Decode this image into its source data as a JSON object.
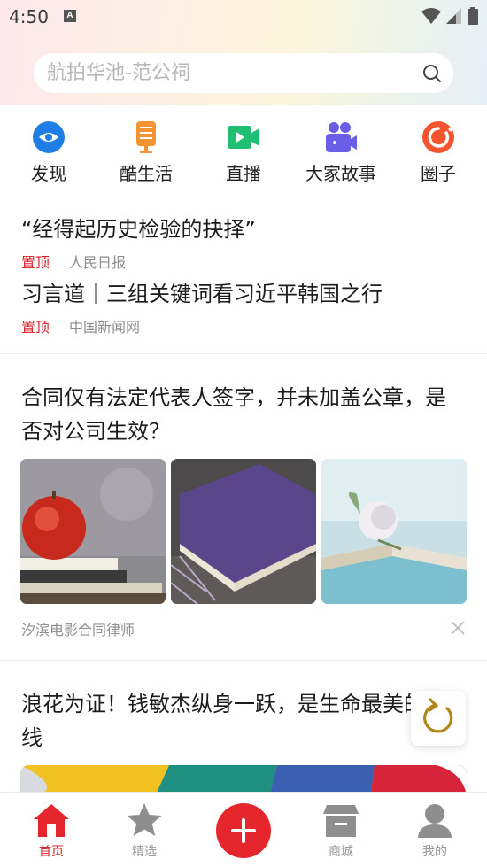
{
  "status": {
    "time": "4:50",
    "badge": "A"
  },
  "search": {
    "placeholder": "航拍华池-范公祠"
  },
  "categories": [
    {
      "label": "发现",
      "icon": "eye-icon",
      "color": "#1f7ee6"
    },
    {
      "label": "酷生活",
      "icon": "microphone-icon",
      "color": "#f39331"
    },
    {
      "label": "直播",
      "icon": "video-camera-icon",
      "color": "#21bf73"
    },
    {
      "label": "大家故事",
      "icon": "people-camera-icon",
      "color": "#6a5de8"
    },
    {
      "label": "圈子",
      "icon": "circle-icon",
      "color": "#f4552f"
    }
  ],
  "pinned": [
    {
      "title": "“经得起历史检验的抉择”",
      "tag": "置顶",
      "source": "人民日报"
    },
    {
      "title": "习言道｜三组关键词看习近平韩国之行",
      "tag": "置顶",
      "source": "中国新闻网"
    }
  ],
  "article1": {
    "title": "合同仅有法定代表人签字，并未加盖公章，是否对公司生效？",
    "source": "汐滨电影合同律师"
  },
  "article2": {
    "title": "浪花为证！钱敏杰纵身一跃，是生命最美的弧线"
  },
  "tabbar": [
    {
      "label": "首页",
      "icon": "home-icon",
      "active": true
    },
    {
      "label": "精选",
      "icon": "star-icon",
      "active": false
    },
    {
      "label": "",
      "icon": "plus-icon",
      "active": false
    },
    {
      "label": "商城",
      "icon": "store-icon",
      "active": false
    },
    {
      "label": "我的",
      "icon": "user-icon",
      "active": false
    }
  ],
  "colors": {
    "accent": "#d8232a",
    "plus": "#e5262c"
  }
}
